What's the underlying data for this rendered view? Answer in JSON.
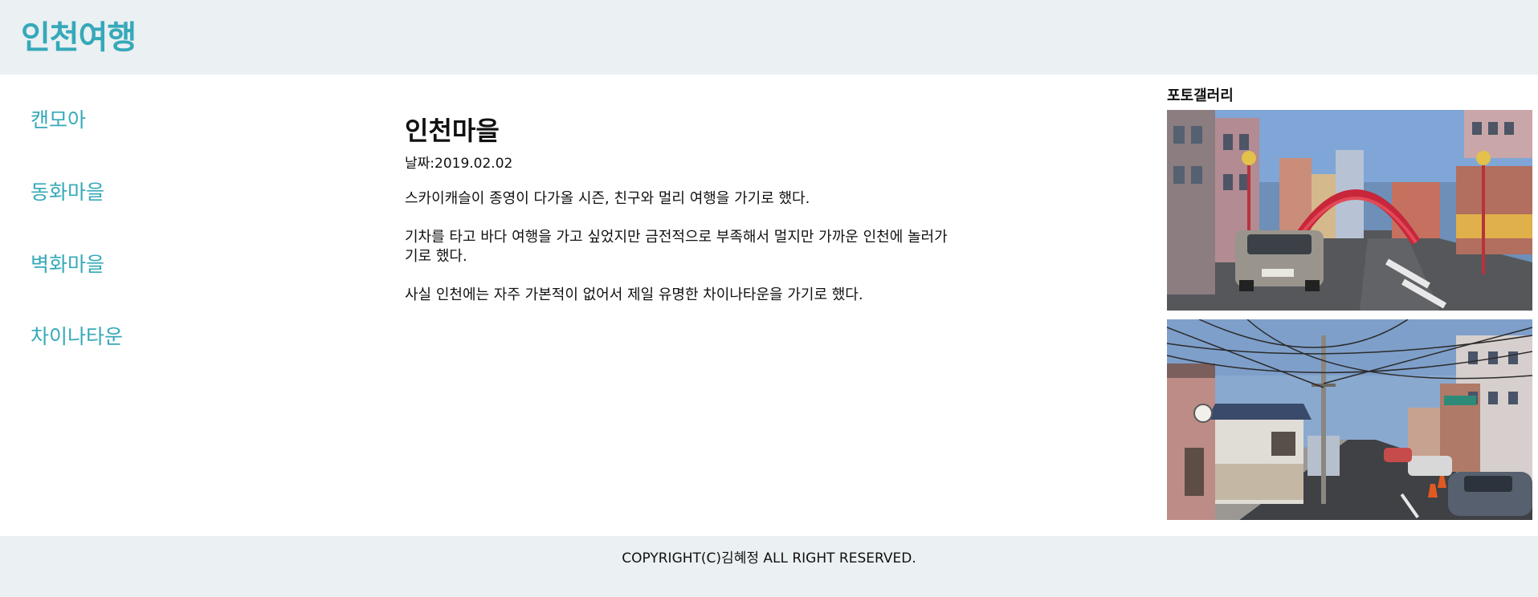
{
  "header": {
    "site_title": "인천여행"
  },
  "sidebar": {
    "items": [
      {
        "label": "캔모아"
      },
      {
        "label": "동화마을"
      },
      {
        "label": "벽화마을"
      },
      {
        "label": "차이나타운"
      }
    ]
  },
  "article": {
    "title": "인천마을",
    "date": "날짜:2019.02.02",
    "paragraphs": [
      "스카이캐슬이 종영이 다가올 시즌, 친구와 멀리 여행을 가기로 했다.",
      "기차를 타고 바다 여행을 가고 싶었지만 금전적으로 부족해서 멀지만 가까운 인천에 놀러가기로 했다.",
      "사실 인천에는 자주 가본적이 없어서 제일 유명한 차이나타운을 가기로 했다."
    ]
  },
  "gallery": {
    "title": "포토갤러리",
    "photos": [
      {
        "subject": "chinatown-street-gate-photo"
      },
      {
        "subject": "village-street-power-lines-photo"
      }
    ]
  },
  "footer": {
    "copyright": "COPYRIGHT(C)김혜정 ALL RIGHT RESERVED."
  },
  "colors": {
    "accent": "#36a9b9",
    "band_background": "#ebf0f2"
  }
}
